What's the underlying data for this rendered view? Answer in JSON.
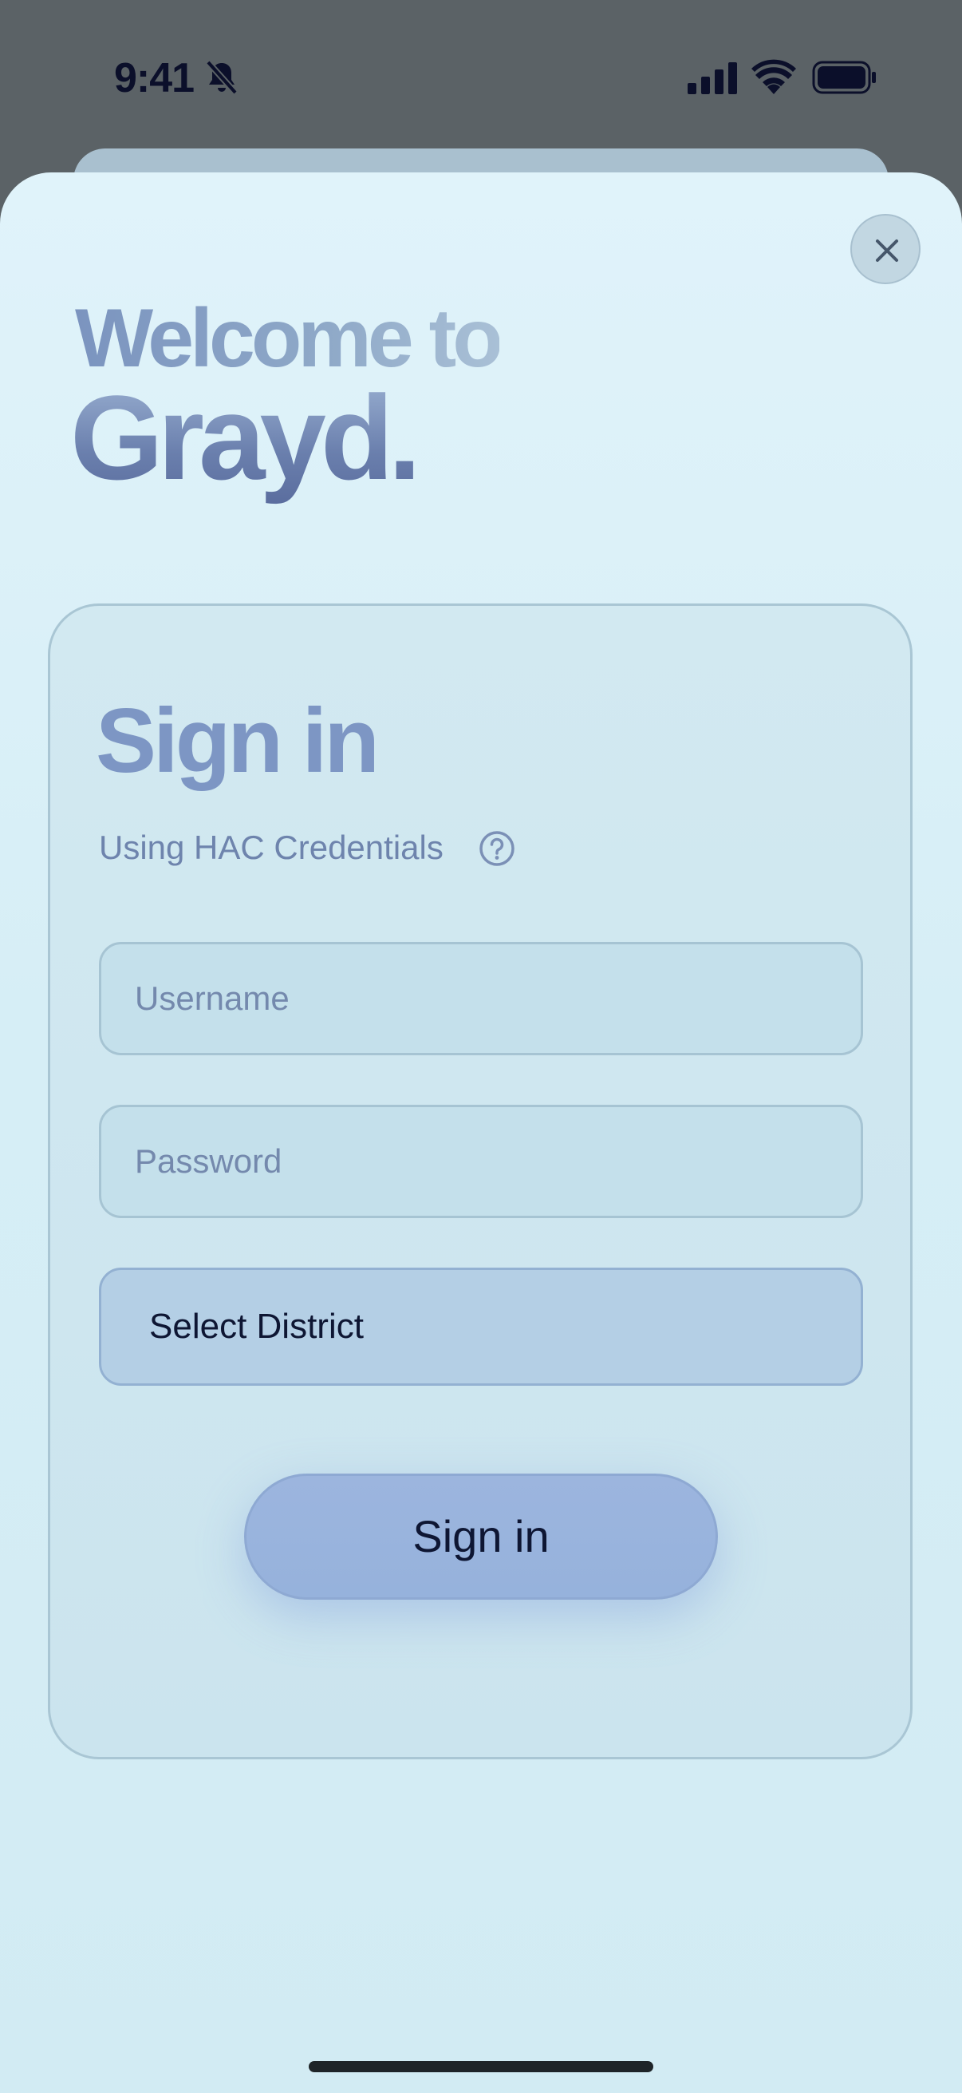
{
  "status_bar": {
    "time": "9:41",
    "icons": [
      "bell-slash-icon",
      "cellular-signal-icon",
      "wifi-icon",
      "battery-icon"
    ]
  },
  "welcome": {
    "line1": "Welcome to",
    "line2": "Grayd."
  },
  "signin_card": {
    "title": "Sign in",
    "subtitle": "Using HAC Credentials",
    "help_icon": "question-circle-icon",
    "username": {
      "value": "",
      "placeholder": "Username"
    },
    "password": {
      "value": "",
      "placeholder": "Password"
    },
    "district_select": {
      "selected": "Select District"
    },
    "submit_label": "Sign in"
  },
  "close_icon": "close-icon",
  "colors": {
    "sheet_background": "#dff2f9",
    "card_background": "#cfe7f0",
    "accent": "#7d96c4",
    "button": "#9ab4dd",
    "dark_text": "#0e1633"
  }
}
